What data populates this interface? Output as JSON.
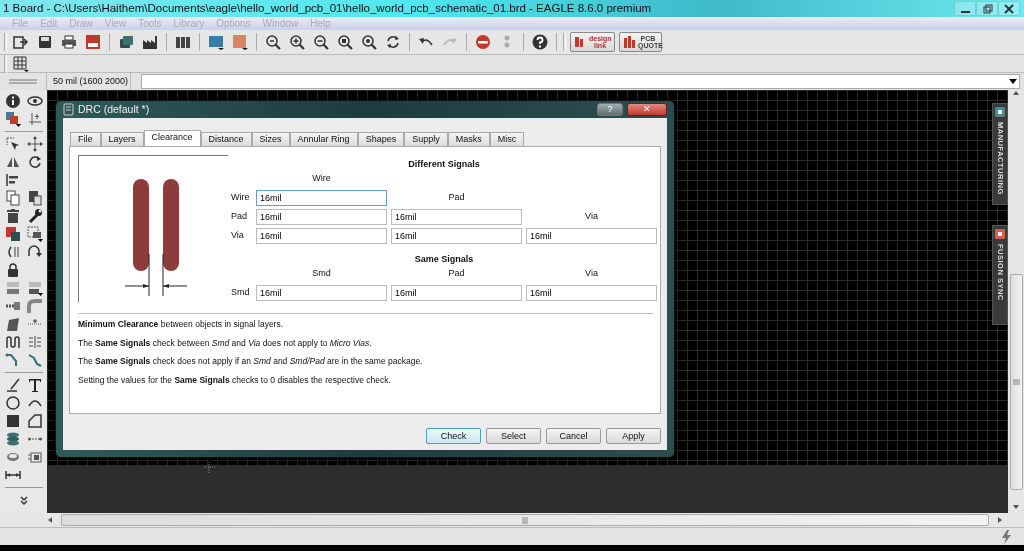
{
  "window": {
    "title": "1 Board - C:\\Users\\Haithem\\Documents\\eagle\\hello_world_pcb_01\\hello_world_pcb_schematic_01.brd - EAGLE 8.6.0 premium"
  },
  "menu": [
    {
      "label": "File",
      "disabled": true
    },
    {
      "label": "Edit",
      "disabled": true
    },
    {
      "label": "Draw",
      "disabled": true
    },
    {
      "label": "View",
      "disabled": true
    },
    {
      "label": "Tools",
      "disabled": true
    },
    {
      "label": "Library",
      "disabled": true
    },
    {
      "label": "Options",
      "disabled": true
    },
    {
      "label": "Window",
      "disabled": true
    },
    {
      "label": "Help",
      "disabled": true
    }
  ],
  "toolbar_links": [
    {
      "kind": "design",
      "label": "design link"
    },
    {
      "kind": "quote",
      "label": "PCB QUOTE"
    }
  ],
  "coordinates": "50 mil (1600 2000)",
  "side_tabs": [
    {
      "kind": "manufacturing",
      "label": "MANUFACTURING"
    },
    {
      "kind": "fusion",
      "label": "FUSION SYNC"
    }
  ],
  "dialog": {
    "title": "DRC (default *)",
    "title_buttons": [
      {
        "kind": "help",
        "glyph": "?"
      },
      {
        "kind": "close",
        "glyph": "✕"
      }
    ],
    "tabs": [
      {
        "label": "File",
        "selected": false
      },
      {
        "label": "Layers",
        "selected": false
      },
      {
        "label": "Clearance",
        "selected": true
      },
      {
        "label": "Distance",
        "selected": false
      },
      {
        "label": "Sizes",
        "selected": false
      },
      {
        "label": "Annular Ring",
        "selected": false
      },
      {
        "label": "Shapes",
        "selected": false
      },
      {
        "label": "Supply",
        "selected": false
      },
      {
        "label": "Masks",
        "selected": false
      },
      {
        "label": "Misc",
        "selected": false
      }
    ],
    "sections": [
      {
        "kind": "triangular",
        "heading": "Different Signals",
        "column_labels": [
          "Wire",
          "Pad",
          "Via"
        ],
        "rows": [
          {
            "label": "Wire",
            "values": [
              "16mil"
            ]
          },
          {
            "label": "Pad",
            "values": [
              "16mil",
              "16mil"
            ]
          },
          {
            "label": "Via",
            "values": [
              "16mil",
              "16mil",
              "16mil"
            ]
          }
        ]
      },
      {
        "kind": "header",
        "heading": "Same Signals",
        "column_labels": [
          "Smd",
          "Pad",
          "Via"
        ],
        "rows": [
          {
            "label": "Smd",
            "values": [
              "16mil",
              "16mil",
              "16mil"
            ]
          }
        ]
      }
    ],
    "notes": [
      "**Minimum Clearance** between objects in signal layers.",
      "The **Same Signals** check between *Smd* and *Via* does not apply to *Micro Vias*.",
      "The **Same Signals** check does not apply if an *Smd* and *Smd/Pad* are in the same package.",
      "Setting the values for the **Same Signals** checks to 0 disables the respective check."
    ],
    "buttons": [
      {
        "label": "Check",
        "default": true
      },
      {
        "label": "Select",
        "default": false
      },
      {
        "label": "Cancel",
        "default": false
      },
      {
        "label": "Apply",
        "default": false
      }
    ]
  }
}
